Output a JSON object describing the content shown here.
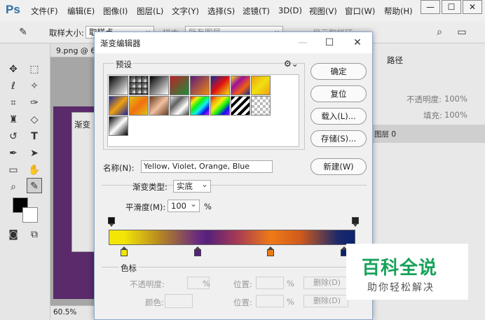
{
  "app": {
    "logo": "Ps",
    "menus": [
      "文件(F)",
      "编辑(E)",
      "图像(I)",
      "图层(L)",
      "文字(Y)",
      "选择(S)",
      "滤镜(T)",
      "3D(D)",
      "视图(V)",
      "窗口(W)",
      "帮助(H)"
    ],
    "window_controls": [
      "—",
      "☐",
      "✕"
    ]
  },
  "options_bar": {
    "sample_size_label": "取样大小:",
    "sample_size_value": "取样点",
    "sample_label": "样本:",
    "sample_value": "所有图层",
    "show_ring_label": "显示取样环"
  },
  "document": {
    "tab_name": "9.png @ 60",
    "zoom": "60.5%",
    "bg_dialog_title": "渐变"
  },
  "right_panel": {
    "tab_paths": "路径",
    "opacity_label": "不透明度:",
    "opacity_value": "100%",
    "fill_label": "填充:",
    "fill_value": "100%",
    "layer_name": "图层 0"
  },
  "dialog": {
    "title": "渐变编辑器",
    "presets_label": "预设",
    "buttons": {
      "ok": "确定",
      "reset": "复位",
      "load": "载入(L)...",
      "save": "存储(S)...",
      "new": "新建(W)"
    },
    "name_label": "名称(N):",
    "name_value": "Yellow, Violet, Orange, Blue",
    "gradient_type_label": "渐变类型:",
    "gradient_type_value": "实底",
    "smoothness_label": "平滑度(M):",
    "smoothness_value": "100",
    "smoothness_unit": "%",
    "color_stops_label": "色标",
    "opacity_label": "不透明度:",
    "location_label": "位置:",
    "percent": "%",
    "delete_label": "删除(D)",
    "color_label": "颜色:",
    "location2_label": "位置:",
    "delete2_label": "删除(D)",
    "color_stops": [
      {
        "color": "#f3e607",
        "location": 5
      },
      {
        "color": "#55207b",
        "location": 35
      },
      {
        "color": "#ef7a17",
        "location": 65
      },
      {
        "color": "#0a236c",
        "location": 95
      }
    ],
    "opacity_stops": [
      0,
      100
    ]
  },
  "watermark": {
    "line1": "百科全说",
    "line2": "助你轻松解决"
  },
  "colors": {
    "dialog_border": "#8aa8c8",
    "watermark_green": "#17a25a"
  }
}
